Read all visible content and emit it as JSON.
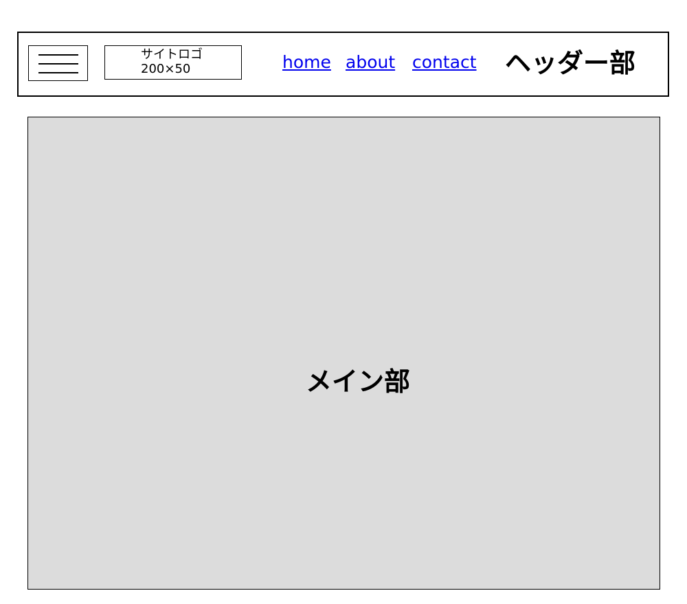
{
  "header": {
    "logo": {
      "line1": "サイトロゴ",
      "line2": "200×50"
    },
    "nav": [
      {
        "label": "home"
      },
      {
        "label": "about"
      },
      {
        "label": "contact"
      }
    ],
    "title": "ヘッダー部"
  },
  "main": {
    "title": "メイン部"
  },
  "colors": {
    "link": "#0000ee",
    "main_background": "#dcdcdc",
    "border": "#000000"
  },
  "icons": {
    "menu": "hamburger-menu-icon"
  }
}
